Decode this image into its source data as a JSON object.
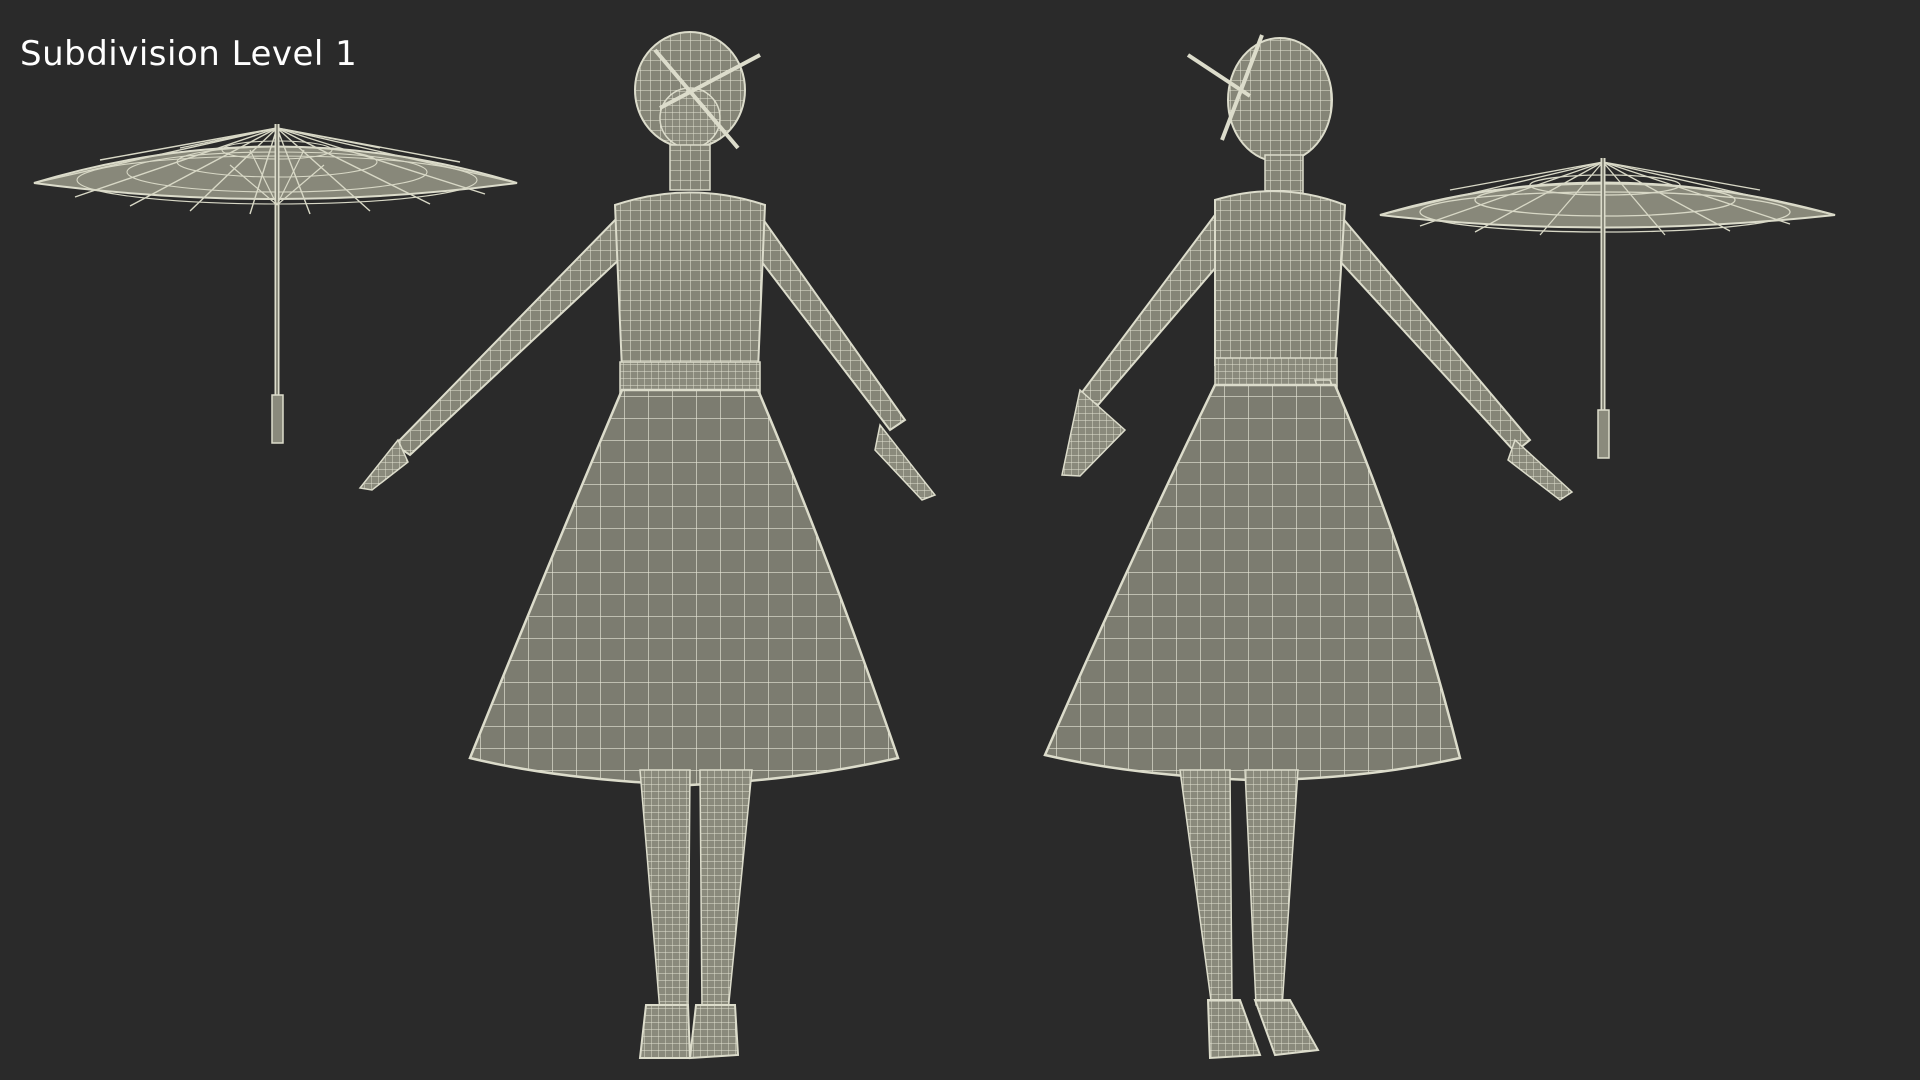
{
  "caption": "Subdivision Level 1",
  "colors": {
    "background": "#2a2a2a",
    "mesh_fill": "#7f7f72",
    "wire": "#d8d8c6",
    "caption": "#ffffff"
  },
  "objects": [
    {
      "name": "umbrella-left"
    },
    {
      "name": "figure-back-view"
    },
    {
      "name": "figure-front-view"
    },
    {
      "name": "umbrella-right"
    }
  ]
}
